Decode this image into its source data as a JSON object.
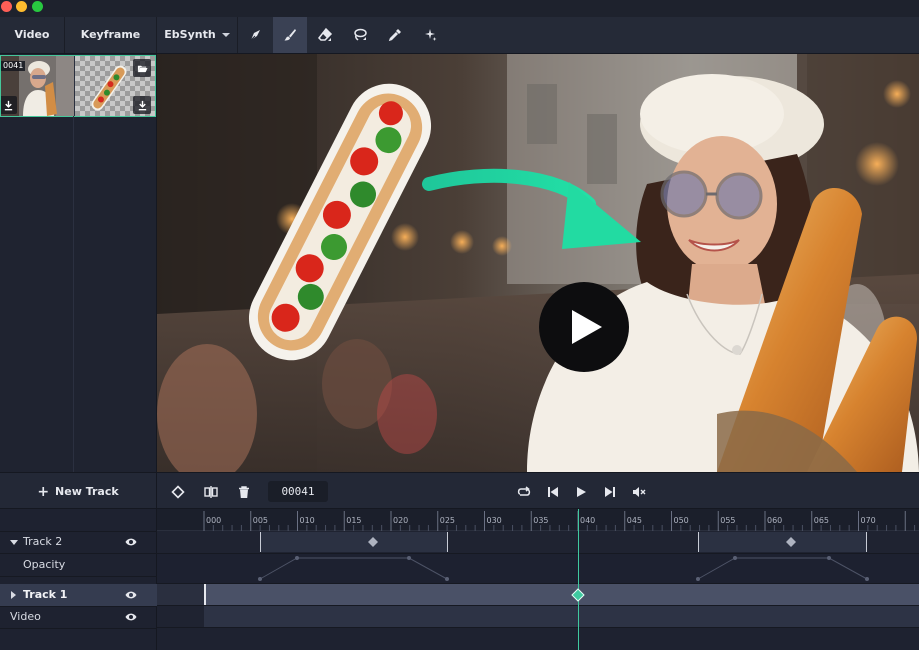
{
  "window": {
    "traffic_lights": [
      "#ff5f57",
      "#febc2e",
      "#28c840"
    ]
  },
  "toolbar": {
    "tabs": [
      {
        "label": "Video"
      },
      {
        "label": "Keyframe"
      },
      {
        "label": "EbSynth"
      }
    ],
    "tools": [
      {
        "icon": "pen-nib-icon"
      },
      {
        "icon": "paint-brush-icon",
        "active": true
      },
      {
        "icon": "eraser-icon"
      },
      {
        "icon": "lasso-icon"
      },
      {
        "icon": "eyedropper-icon"
      },
      {
        "icon": "magic-sparkle-icon"
      }
    ]
  },
  "sidebar": {
    "frame_badge": "0041",
    "buttons": [
      "folder-open-icon",
      "download-icon",
      "download-icon"
    ]
  },
  "preview": {
    "play_icon": "play-icon"
  },
  "transport": {
    "new_track_label": "New Track",
    "current_frame": "00041",
    "buttons": [
      "keyframe-diamond-icon",
      "split-icon",
      "trash-icon",
      "loop-icon",
      "skip-back-icon",
      "play-icon",
      "skip-forward-icon",
      "mute-icon"
    ]
  },
  "timeline": {
    "ruler_ticks": [
      "000",
      "005",
      "010",
      "015",
      "020",
      "025",
      "030",
      "035",
      "040",
      "045",
      "050",
      "055",
      "060",
      "065",
      "070"
    ],
    "tracks": [
      {
        "label": "Track 2",
        "expanded": true,
        "visible": true
      },
      {
        "label": "Opacity",
        "is_property": true
      },
      {
        "label": "Track 1",
        "expanded": false,
        "visible": true,
        "selected": true
      },
      {
        "label": "Video",
        "visible": true
      }
    ],
    "playhead_frame": 40,
    "accent": "#3fc9a0"
  }
}
